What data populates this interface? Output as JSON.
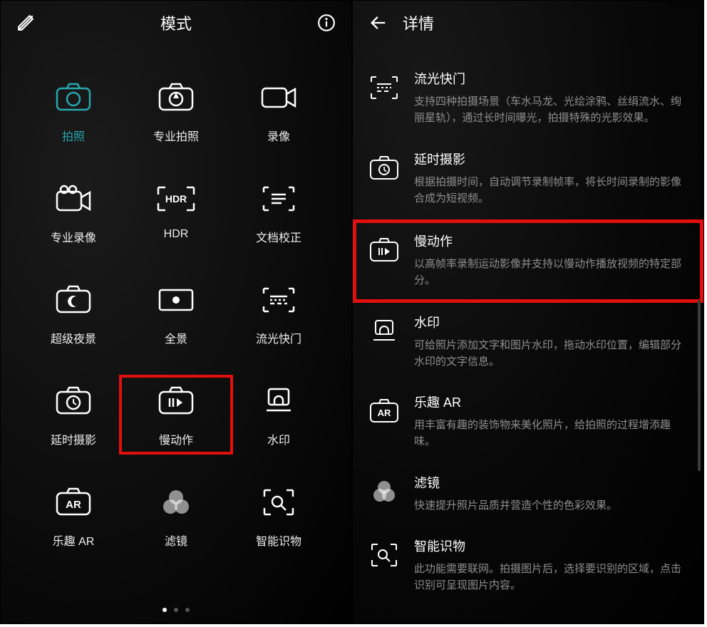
{
  "left": {
    "title": "模式",
    "modes": [
      {
        "label": "拍照",
        "active": true
      },
      {
        "label": "专业拍照"
      },
      {
        "label": "录像"
      },
      {
        "label": "专业录像"
      },
      {
        "label": "HDR"
      },
      {
        "label": "文档校正"
      },
      {
        "label": "超级夜景"
      },
      {
        "label": "全景"
      },
      {
        "label": "流光快门"
      },
      {
        "label": "延时摄影"
      },
      {
        "label": "慢动作",
        "highlight": true
      },
      {
        "label": "水印"
      },
      {
        "label": "乐趣 AR"
      },
      {
        "label": "滤镜"
      },
      {
        "label": "智能识物"
      }
    ]
  },
  "right": {
    "title": "详情",
    "details": [
      {
        "title": "流光快门",
        "desc": "支持四种拍摄场景（车水马龙、光绘涂鸦、丝绢流水、绚丽星轨），通过长时间曝光，拍摄特殊的光影效果。"
      },
      {
        "title": "延时摄影",
        "desc": "根据拍摄时间，自动调节录制帧率，将长时间录制的影像合成为短视频。"
      },
      {
        "title": "慢动作",
        "desc": "以高帧率录制运动影像并支持以慢动作播放视频的特定部分。",
        "highlight": true
      },
      {
        "title": "水印",
        "desc": "可给照片添加文字和图片水印，拖动水印位置，编辑部分水印的文字信息。"
      },
      {
        "title": "乐趣 AR",
        "desc": "用丰富有趣的装饰物来美化照片，给拍照的过程增添趣味。"
      },
      {
        "title": "滤镜",
        "desc": "快速提升照片品质并营造个性的色彩效果。"
      },
      {
        "title": "智能识物",
        "desc": "此功能需要联网。拍摄图片后，选择要识别的区域，点击识别可呈现图片内容。"
      }
    ]
  }
}
